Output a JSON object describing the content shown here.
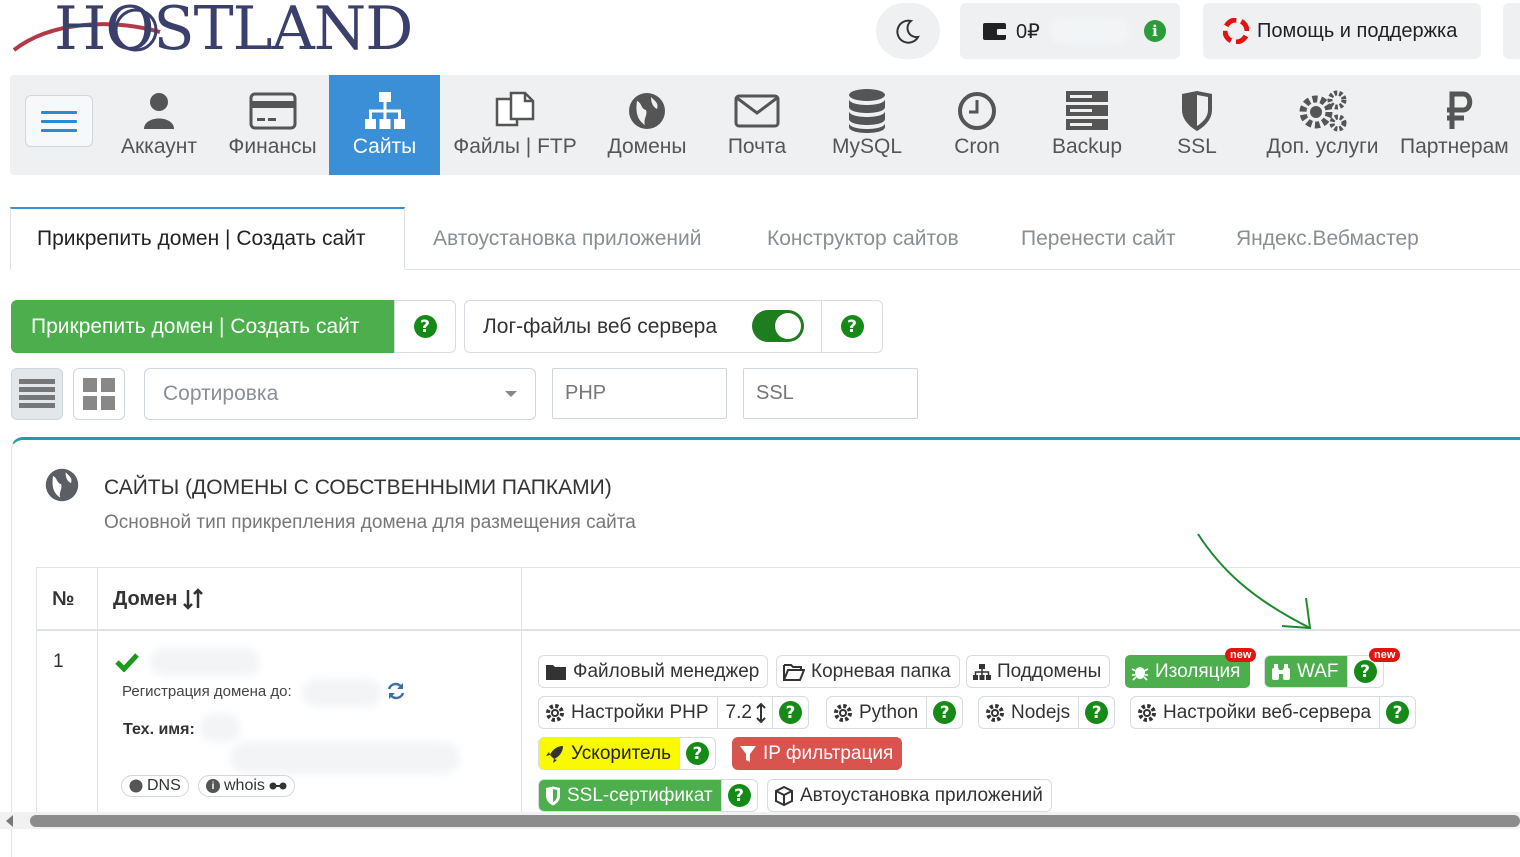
{
  "header": {
    "logo_text": "HOSTLAND",
    "balance": "0₽",
    "help_label": "Помощь и поддержка"
  },
  "nav": {
    "items": [
      {
        "label": "Аккаунт"
      },
      {
        "label": "Финансы"
      },
      {
        "label": "Сайты"
      },
      {
        "label": "Файлы | FTP"
      },
      {
        "label": "Домены"
      },
      {
        "label": "Почта"
      },
      {
        "label": "MySQL"
      },
      {
        "label": "Cron"
      },
      {
        "label": "Backup"
      },
      {
        "label": "SSL"
      },
      {
        "label": "Доп. услуги"
      },
      {
        "label": "Партнерам"
      }
    ],
    "active": "Сайты"
  },
  "tabs": [
    {
      "label": "Прикрепить домен | Создать сайт"
    },
    {
      "label": "Автоустановка приложений"
    },
    {
      "label": "Конструктор сайтов"
    },
    {
      "label": "Перенести сайт"
    },
    {
      "label": "Яндекс.Вебмастер"
    }
  ],
  "actions": {
    "attach_button": "Прикрепить домен | Создать сайт",
    "log_label": "Лог-файлы веб сервера",
    "log_enabled": true,
    "help_glyph": "?"
  },
  "filters": {
    "sort_placeholder": "Сортировка",
    "php_placeholder": "PHP",
    "ssl_placeholder": "SSL"
  },
  "section": {
    "title": "САЙТЫ (ДОМЕНЫ С СОБСТВЕННЫМИ ПАПКАМИ)",
    "subtitle": "Основной тип прикрепления домена для размещения сайта"
  },
  "table": {
    "col_num": "№",
    "col_domain": "Домен",
    "rows": [
      {
        "num": "1",
        "reg_label": "Регистрация домена до:",
        "tech_label": "Тех. имя:",
        "dns_label": "DNS",
        "whois_label": "whois",
        "buttons": {
          "file_manager": "Файловый менеджер",
          "root_folder": "Корневая папка",
          "subdomains": "Поддомены",
          "isolation": "Изоляция",
          "waf": "WAF",
          "new_badge": "new",
          "php_settings": "Настройки PHP",
          "php_version": "7.2",
          "python": "Python",
          "nodejs": "Nodejs",
          "web_settings": "Настройки веб-сервера",
          "accelerator": "Ускоритель",
          "ip_filter": "IP фильтрация",
          "ssl_cert": "SSL-сертификат",
          "autoinstall": "Автоустановка приложений"
        }
      }
    ]
  },
  "colors": {
    "nav_active": "#3a8fd6",
    "green": "#4cae4c",
    "help_green": "#168a16",
    "teal_border": "#1aa0a6",
    "red": "#d9534f",
    "yellow": "#f9f900"
  }
}
